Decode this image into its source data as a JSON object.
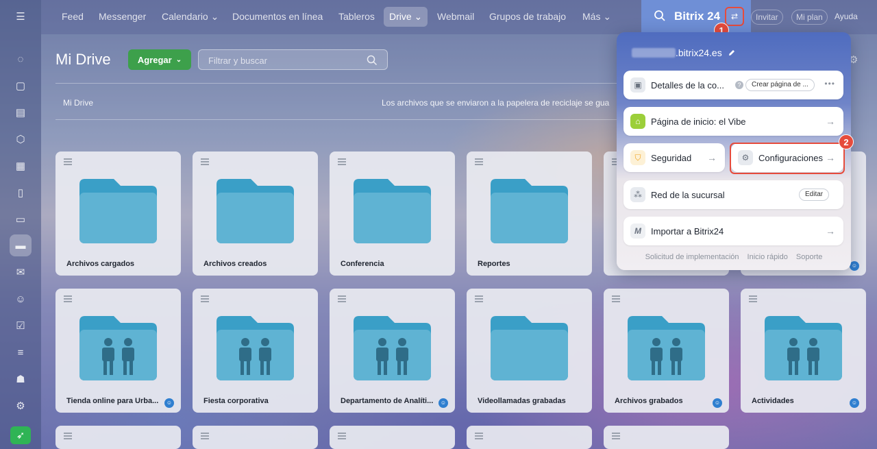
{
  "nav": {
    "items": [
      "Feed",
      "Messenger",
      "Calendario",
      "Documentos en línea",
      "Tableros",
      "Drive",
      "Webmail",
      "Grupos de trabajo",
      "Más"
    ],
    "brand": "Bitrix 24",
    "invite": "Invitar",
    "plan": "Mi plan",
    "help": "Ayuda"
  },
  "page": {
    "title": "Mi Drive",
    "add_label": "Agregar",
    "search_placeholder": "Filtrar y buscar",
    "breadcrumb": "Mi Drive",
    "trash_note": "Los archivos que se enviaron a la papelera de reciclaje se gua"
  },
  "folders": {
    "row1": [
      "Archivos cargados",
      "Archivos creados",
      "Conferencia",
      "Reportes"
    ],
    "row2": [
      "Tienda online para Urba...",
      "Fiesta corporativa",
      "Departamento de Analíti...",
      "Videollamadas grabadas",
      "Archivos grabados",
      "Actividades"
    ]
  },
  "popup": {
    "domain": ".bitrix24.es",
    "company_details": "Detalles de la co...",
    "create_page": "Crear página de ...",
    "home_page": "Página de inicio: el Vibe",
    "security": "Seguridad",
    "settings": "Configuraciones",
    "branch_network": "Red de la sucursal",
    "edit": "Editar",
    "import": "Importar a Bitrix24",
    "footer": [
      "Solicitud de implementación",
      "Inicio rápido",
      "Soporte"
    ]
  },
  "annotations": {
    "step1": "1",
    "step2": "2"
  },
  "colors": {
    "accent_red": "#e64b3c",
    "add_green": "#3da04b",
    "folder_blue": "#3a9fc7",
    "brand_blue": "#6f8fd6"
  }
}
